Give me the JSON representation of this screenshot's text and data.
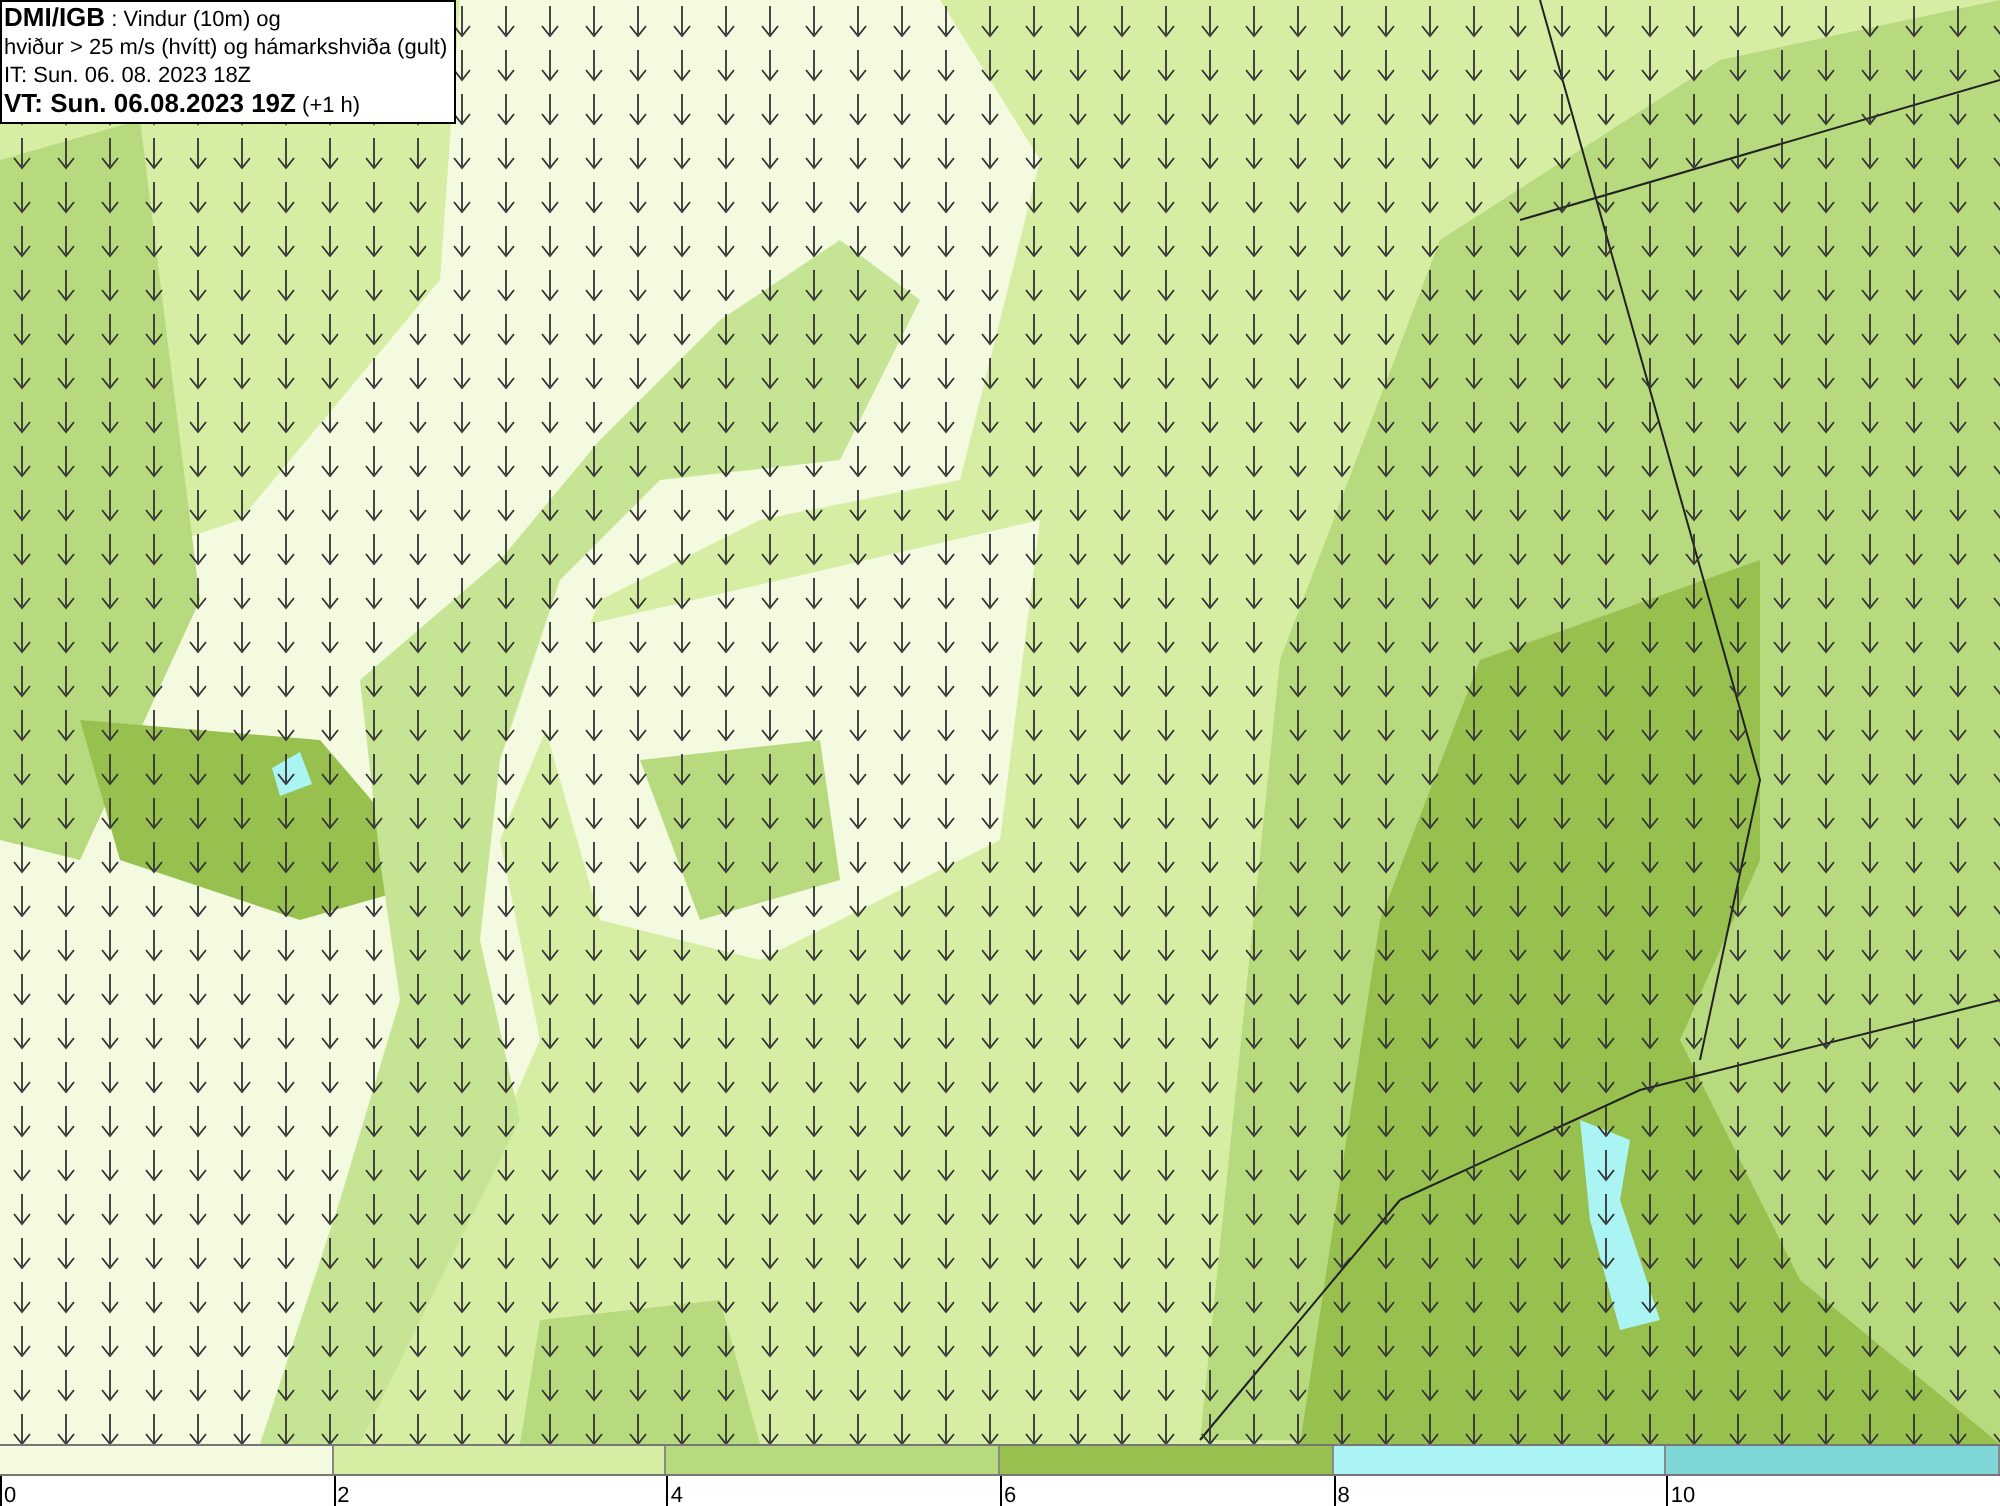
{
  "legend_box": {
    "lines": [
      "**DMI/IGB** : Vindur (10m) og",
      "hviður > 25 m/s (hvítt) og hámarkshviða (gult)",
      "IT: Sun. 06. 08. 2023 18Z",
      "**VT: Sun. 06.08.2023 19Z** (+1 h)"
    ]
  },
  "color_scale": {
    "segments": [
      {
        "color": "#f4fadf",
        "label": "0"
      },
      {
        "color": "#d6eea4",
        "label": "2"
      },
      {
        "color": "#b8da7e",
        "label": "4"
      },
      {
        "color": "#98c04e",
        "label": "6"
      },
      {
        "color": "#aaf4f4",
        "label": "8"
      },
      {
        "color": "#7ed6d6",
        "label": "10"
      }
    ]
  }
}
